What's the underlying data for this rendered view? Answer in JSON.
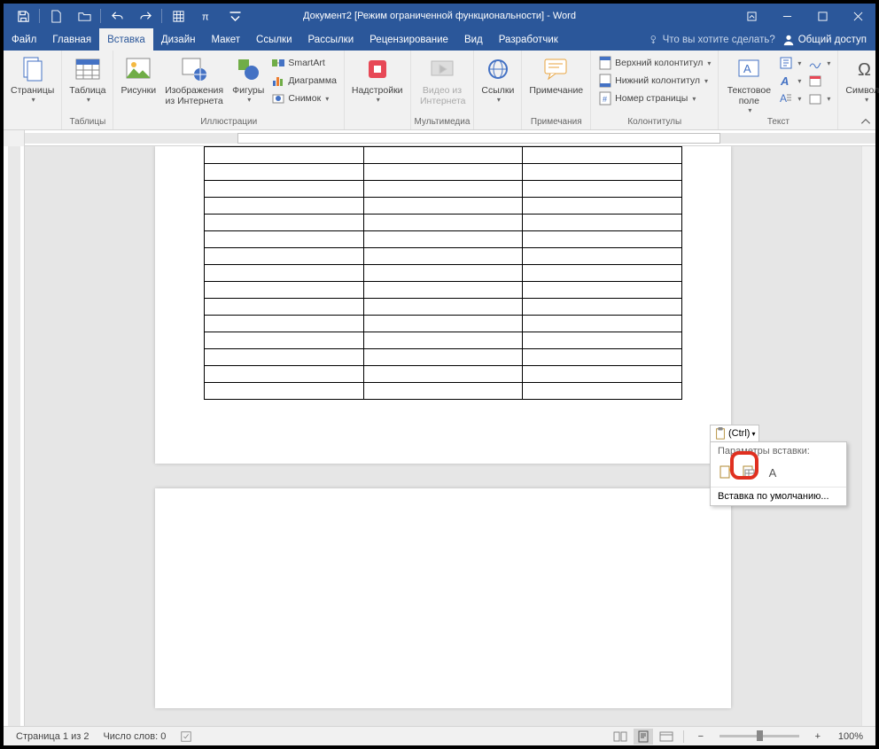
{
  "title": "Документ2 [Режим ограниченной функциональности] - Word",
  "menu": {
    "file": "Файл",
    "home": "Главная",
    "insert": "Вставка",
    "design": "Дизайн",
    "layout": "Макет",
    "references": "Ссылки",
    "mailings": "Рассылки",
    "review": "Рецензирование",
    "view": "Вид",
    "developer": "Разработчик",
    "tell_me": "Что вы хотите сделать?",
    "share": "Общий доступ"
  },
  "ribbon": {
    "pages": {
      "label": "Страницы",
      "btn": "Страницы"
    },
    "tables": {
      "label": "Таблицы",
      "btn": "Таблица"
    },
    "illustrations": {
      "label": "Иллюстрации",
      "pictures": "Рисунки",
      "online_pictures": "Изображения из Интернета",
      "shapes": "Фигуры",
      "smartart": "SmartArt",
      "chart": "Диаграмма",
      "screenshot": "Снимок"
    },
    "addins": {
      "label": "",
      "btn": "Надстройки"
    },
    "media": {
      "label": "Мультимедиа",
      "btn": "Видео из Интернета"
    },
    "links": {
      "label": "",
      "btn": "Ссылки"
    },
    "comments": {
      "label": "Примечания",
      "btn": "Примечание"
    },
    "headerfooter": {
      "label": "Колонтитулы",
      "header": "Верхний колонтитул",
      "footer": "Нижний колонтитул",
      "pagenum": "Номер страницы"
    },
    "text": {
      "label": "Текст",
      "textbox": "Текстовое поле"
    },
    "symbols": {
      "label": "",
      "btn": "Символы"
    }
  },
  "paste_popup": {
    "btn": "(Ctrl)",
    "header": "Параметры вставки:",
    "default": "Вставка по умолчанию...",
    "opt_text": "A"
  },
  "status": {
    "page": "Страница 1 из 2",
    "words": "Число слов: 0",
    "zoom": "100%"
  },
  "table": {
    "rows": 15,
    "cols": 3
  }
}
